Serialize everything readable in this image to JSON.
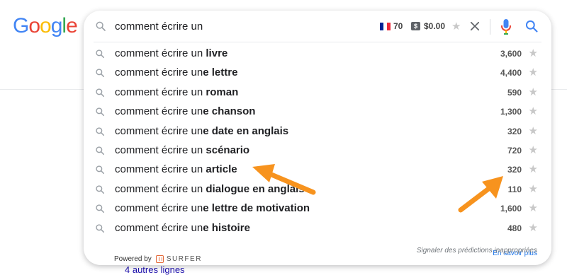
{
  "logo": {
    "letters": [
      {
        "char": "G",
        "color": "#4285F4"
      },
      {
        "char": "o",
        "color": "#EA4335"
      },
      {
        "char": "o",
        "color": "#FBBC05"
      },
      {
        "char": "g",
        "color": "#4285F4"
      },
      {
        "char": "l",
        "color": "#34A853"
      },
      {
        "char": "e",
        "color": "#EA4335"
      }
    ]
  },
  "search": {
    "query": "comment écrire un",
    "flag_count": "70",
    "dollar_badge": "$",
    "cpc": "$0.00"
  },
  "suggestions": [
    {
      "prefix": "comment écrire un",
      "completion": " livre",
      "volume": "3,600"
    },
    {
      "prefix": "comment écrire un",
      "completion": "e lettre",
      "volume": "4,400"
    },
    {
      "prefix": "comment écrire un",
      "completion": " roman",
      "volume": "590"
    },
    {
      "prefix": "comment écrire un",
      "completion": "e chanson",
      "volume": "1,300"
    },
    {
      "prefix": "comment écrire un",
      "completion": "e date en anglais",
      "volume": "320"
    },
    {
      "prefix": "comment écrire un",
      "completion": " scénario",
      "volume": "720"
    },
    {
      "prefix": "comment écrire un",
      "completion": " article",
      "volume": "320"
    },
    {
      "prefix": "comment écrire un",
      "completion": " dialogue en anglais",
      "volume": "110"
    },
    {
      "prefix": "comment écrire un",
      "completion": "e lettre de motivation",
      "volume": "1,600"
    },
    {
      "prefix": "comment écrire un",
      "completion": "e histoire",
      "volume": "480"
    }
  ],
  "footer": {
    "powered_by": "Powered by",
    "brand": "SURFER",
    "report": "Signaler des prédictions inappropriées",
    "learn_more": "En savoir plus"
  },
  "behind": {
    "more_lines": "4 autres lignes"
  },
  "colors": {
    "arrow": "#F7931E",
    "flag_blue": "#002395",
    "flag_red": "#ED2939",
    "mic_blue": "#4285F4",
    "mic_red": "#EA4335",
    "search_blue": "#4285F4"
  }
}
